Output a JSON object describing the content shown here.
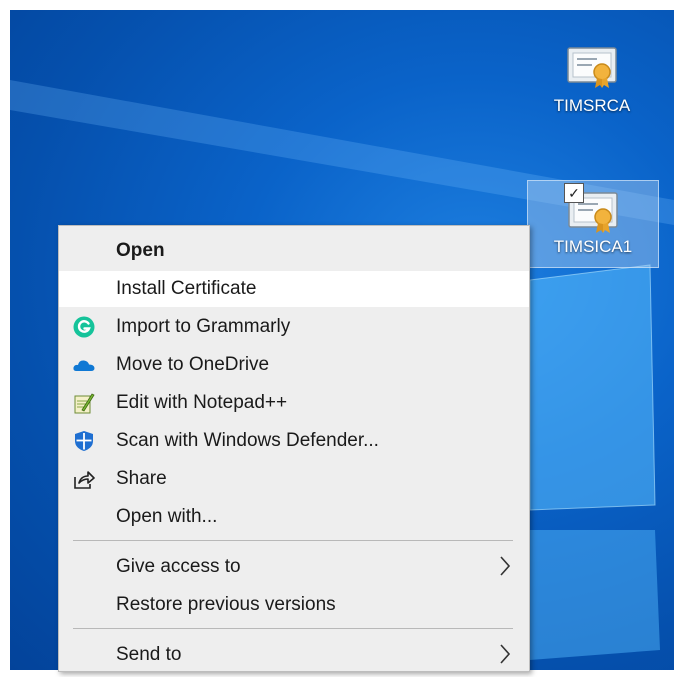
{
  "desktop": {
    "icons": [
      {
        "label": "TIMSRCA",
        "icon": "certificate-icon",
        "selected": false
      },
      {
        "label": "TIMSICA1",
        "icon": "certificate-icon",
        "selected": true
      }
    ]
  },
  "context_menu": {
    "items": [
      {
        "label": "Open",
        "icon": null,
        "bold": true
      },
      {
        "label": "Install Certificate",
        "icon": null,
        "highlighted": true
      },
      {
        "label": "Import to Grammarly",
        "icon": "grammarly-icon"
      },
      {
        "label": "Move to OneDrive",
        "icon": "onedrive-icon"
      },
      {
        "label": "Edit with Notepad++",
        "icon": "notepad-plus-plus-icon"
      },
      {
        "label": "Scan with Windows Defender...",
        "icon": "windows-defender-icon"
      },
      {
        "label": "Share",
        "icon": "share-icon"
      },
      {
        "label": "Open with...",
        "icon": null
      },
      {
        "label": "Give access to",
        "icon": null,
        "submenu": true
      },
      {
        "label": "Restore previous versions",
        "icon": null
      },
      {
        "label": "Send to",
        "icon": null,
        "submenu": true
      }
    ]
  },
  "colors": {
    "desktop_blue": "#0a63c9",
    "menu_bg": "#eeeeee",
    "menu_highlight": "#ffffff",
    "grammarly_green": "#15c39a",
    "onedrive_blue": "#0f78d4",
    "defender_blue": "#1f6fd1"
  }
}
